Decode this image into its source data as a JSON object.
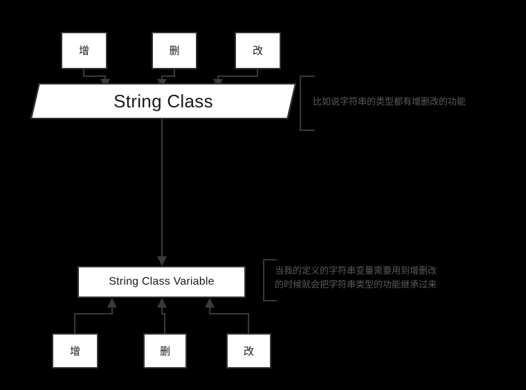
{
  "diagram": {
    "background_color": "#000000",
    "node_fill": "#ffffff",
    "node_border": "#333333",
    "connector_color": "#3a3a3a",
    "annotation_color": "#5a5a5a",
    "title": "String Class"
  },
  "top_operations": [
    {
      "label": "增"
    },
    {
      "label": "删"
    },
    {
      "label": "改"
    }
  ],
  "parent_class": {
    "label": "String Class"
  },
  "child_class": {
    "label": "String Class Variable"
  },
  "bottom_operations": [
    {
      "label": "增"
    },
    {
      "label": "删"
    },
    {
      "label": "改"
    }
  ],
  "annotations": [
    {
      "id": "parent-note",
      "text": "比如说字符串的类型都有增删改的功能"
    },
    {
      "id": "child-note",
      "text": "当我的定义的字符串变量需要用到增删改\n的时候就会把字符串类型的功能继承过来"
    }
  ]
}
